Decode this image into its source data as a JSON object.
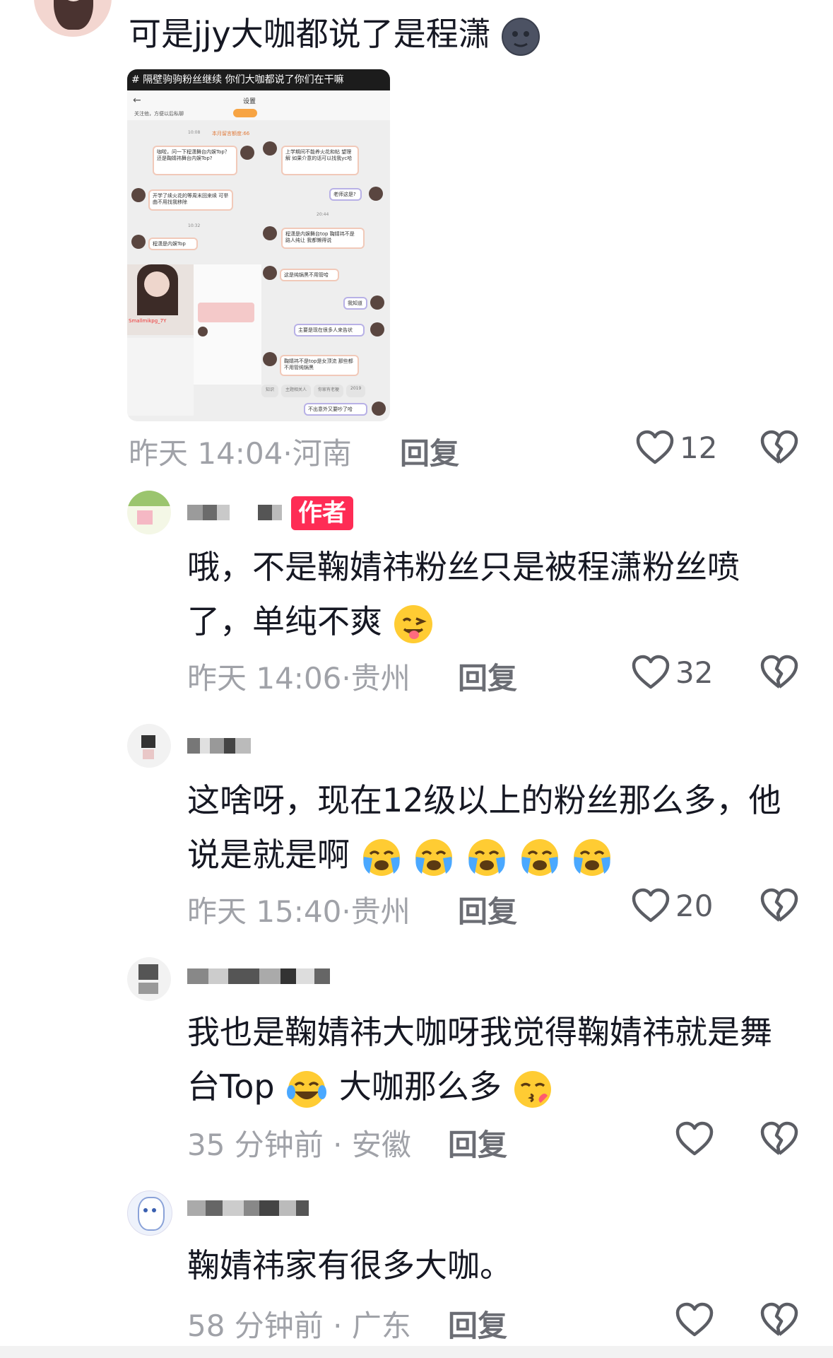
{
  "comments": [
    {
      "text": "可是jjy大咖都说了是程潇",
      "time": "昨天 14:04",
      "location": "河南",
      "reply_label": "回复",
      "likes": "12",
      "screenshot": {
        "header": "# 隔壁驹驹粉丝继续 你们大咖都说了你们在干嘛",
        "settings": "设置",
        "follow_hint": "关注他，方便以后私聊",
        "quota": "本月留言额度:66",
        "time1": "10:08",
        "time2": "20:44",
        "time3": "10:32",
        "msgs": [
          "咖啦，问一下程潇舞台内娱Top？还是鞠婧祎舞台内娱Top?",
          "上学期间不能养火花和帖 望理解 如果介意的话可以找我yc哈",
          "开学了续火花的等周末回来续 可举曲不用找我移除",
          "老师这是?",
          "程潇是内娱舞台top 鞠婧祎不是 路人纯让 我都懒得说",
          "程潇是内娱Top",
          "这是纯锅黑不用管哈",
          "我知道",
          "主要是现在很多人来告状",
          "鞠婧祎不是top是女顶流 那些都不用管纯锅黑",
          "不出意外又要吵了哈"
        ],
        "profile_name": "Smallmikpg_7Y",
        "footer_tags": [
          "知识",
          "主题相关人",
          "你家有老梗",
          "2019"
        ]
      }
    },
    {
      "author_badge": "作者",
      "text": "哦，不是鞠婧祎粉丝只是被程潇粉丝喷了，单纯不爽",
      "time": "昨天 14:06",
      "location": "贵州",
      "reply_label": "回复",
      "likes": "32"
    },
    {
      "text": "这啥呀，现在12级以上的粉丝那么多，他说是就是啊",
      "time": "昨天 15:40",
      "location": "贵州",
      "reply_label": "回复",
      "likes": "20"
    },
    {
      "text": "我也是鞠婧祎大咖呀我觉得鞠婧祎就是舞台Top",
      "text_tail": "大咖那么多",
      "time": "35 分钟前",
      "location": "安徽",
      "reply_label": "回复",
      "likes": ""
    },
    {
      "text": "鞠婧祎家有很多大咖。",
      "time": "58 分钟前",
      "location": "广东",
      "reply_label": "回复",
      "likes": ""
    }
  ],
  "icons": {
    "like": "heart-outline-icon",
    "dislike": "broken-heart-icon",
    "emoji_moon": "new-moon-face-emoji",
    "emoji_wink": "winking-tongue-emoji",
    "emoji_cry": "loudly-crying-emoji",
    "emoji_joy": "tears-of-joy-emoji",
    "emoji_kiss": "kissing-emoji"
  },
  "colors": {
    "author_badge_bg": "#fe2c55",
    "meta_text": "#a0a2a8",
    "body_text": "#161823"
  }
}
